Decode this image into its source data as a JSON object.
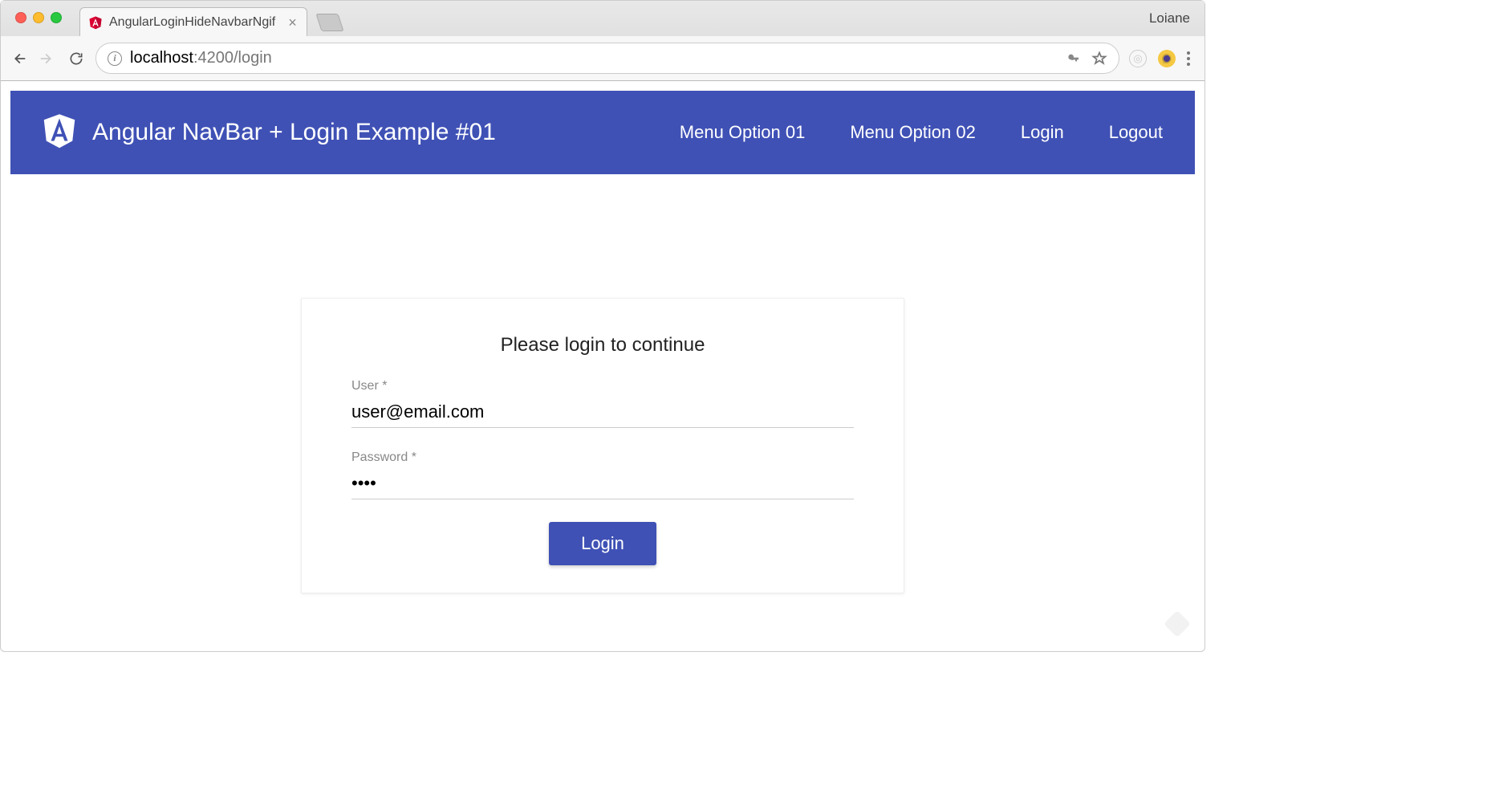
{
  "browser": {
    "profile_name": "Loiane",
    "tab_title": "AngularLoginHideNavbarNgif",
    "url_host": "localhost",
    "url_port_path": ":4200/login"
  },
  "navbar": {
    "title": "Angular NavBar + Login Example #01",
    "links": [
      {
        "label": "Menu Option 01"
      },
      {
        "label": "Menu Option 02"
      },
      {
        "label": "Login"
      },
      {
        "label": "Logout"
      }
    ]
  },
  "login": {
    "heading": "Please login to continue",
    "user_label": "User *",
    "user_value": "user@email.com",
    "password_label": "Password *",
    "password_value": "pass",
    "button_label": "Login"
  },
  "colors": {
    "primary": "#3f51b5"
  }
}
